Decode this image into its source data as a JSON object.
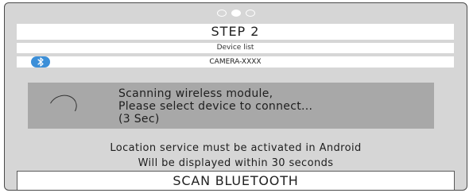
{
  "pagination": {
    "total": 3,
    "active_index": 1
  },
  "step": {
    "title": "STEP 2"
  },
  "device_list": {
    "header": "Device list",
    "items": [
      {
        "name": "CAMERA-XXXX",
        "icon": "bluetooth-icon"
      }
    ]
  },
  "scan": {
    "line1": "Scanning wireless module,",
    "line2": "Please select device to connect...",
    "line3": "(3 Sec)"
  },
  "notice": {
    "line1": "Location service must be activated in Android",
    "line2": "Will be displayed within 30 seconds"
  },
  "button": {
    "label": "SCAN BLUETOOTH"
  },
  "colors": {
    "accent": "#3c8fd8",
    "panel": "#d6d6d6",
    "scan_box": "#a8a8a8"
  }
}
